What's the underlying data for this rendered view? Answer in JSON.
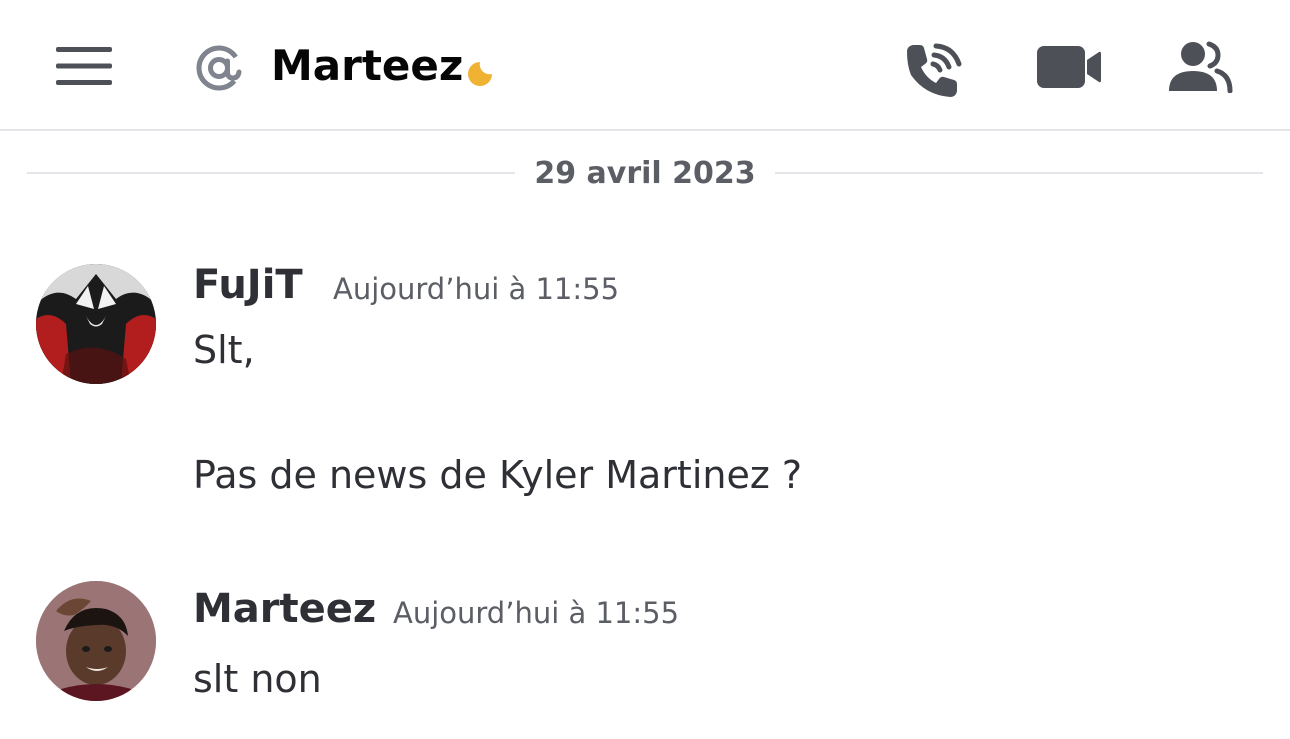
{
  "header": {
    "title": "Marteez",
    "status": "idle",
    "icons": {
      "menu": "hamburger-menu-icon",
      "channel_type": "at-sign-icon",
      "status": "moon-icon",
      "call": "phone-call-icon",
      "video": "video-camera-icon",
      "members": "members-icon"
    }
  },
  "divider": {
    "date": "29 avril 2023"
  },
  "messages": [
    {
      "author": "FuJiT",
      "timestamp": "Aujourd’hui à 11:55",
      "lines": [
        "Slt,",
        "Pas de news de Kyler Martinez ?"
      ]
    },
    {
      "author": "Marteez",
      "timestamp": "Aujourd’hui à 11:55",
      "lines": [
        "slt non"
      ]
    }
  ],
  "colors": {
    "status_idle": "#f0b232",
    "icon_dark": "#4e5058",
    "at_icon": "#80848e",
    "divider": "#e3e5e8",
    "muted_text": "#5c5e66"
  }
}
